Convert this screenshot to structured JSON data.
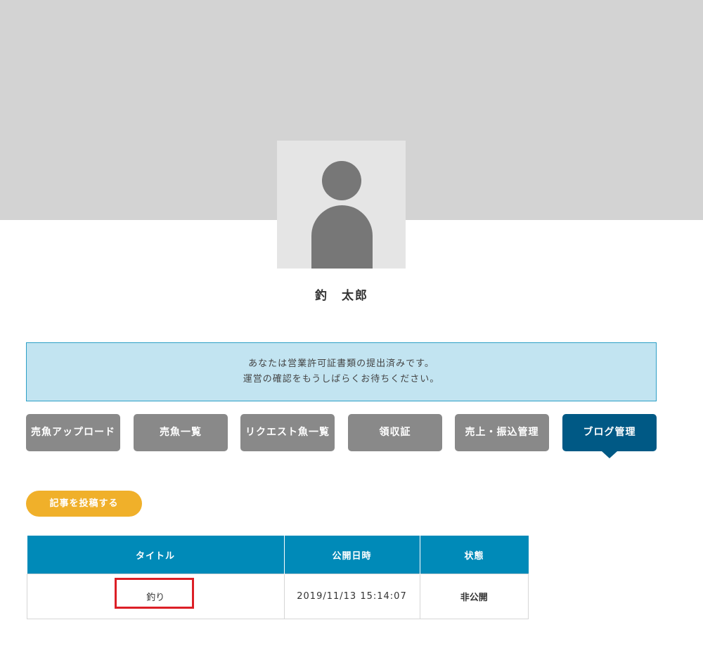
{
  "profile": {
    "name": "釣　太郎",
    "avatar_icon": "user-silhouette-icon"
  },
  "notice": {
    "line1": "あなたは営業許可証書類の提出済みです。",
    "line2": "運営の確認をもうしばらくお待ちください。"
  },
  "nav": {
    "items": [
      {
        "label": "売魚アップロード",
        "active": false
      },
      {
        "label": "売魚一覧",
        "active": false
      },
      {
        "label": "リクエスト魚一覧",
        "active": false
      },
      {
        "label": "領収証",
        "active": false
      },
      {
        "label": "売上・振込管理",
        "active": false
      },
      {
        "label": "ブログ管理",
        "active": true
      }
    ]
  },
  "actions": {
    "post_label": "記事を投稿する"
  },
  "table": {
    "headers": [
      "タイトル",
      "公開日時",
      "状態"
    ],
    "rows": [
      {
        "title": "釣り",
        "published_at": "2019/11/13 15:14:07",
        "status": "非公開"
      }
    ]
  },
  "colors": {
    "cover": "#d3d3d3",
    "notice_bg": "#c2e4f1",
    "nav_inactive": "#898989",
    "nav_active": "#005985",
    "post_button": "#f0b02a",
    "table_header": "#008ab8",
    "highlight": "#dc1f26"
  }
}
